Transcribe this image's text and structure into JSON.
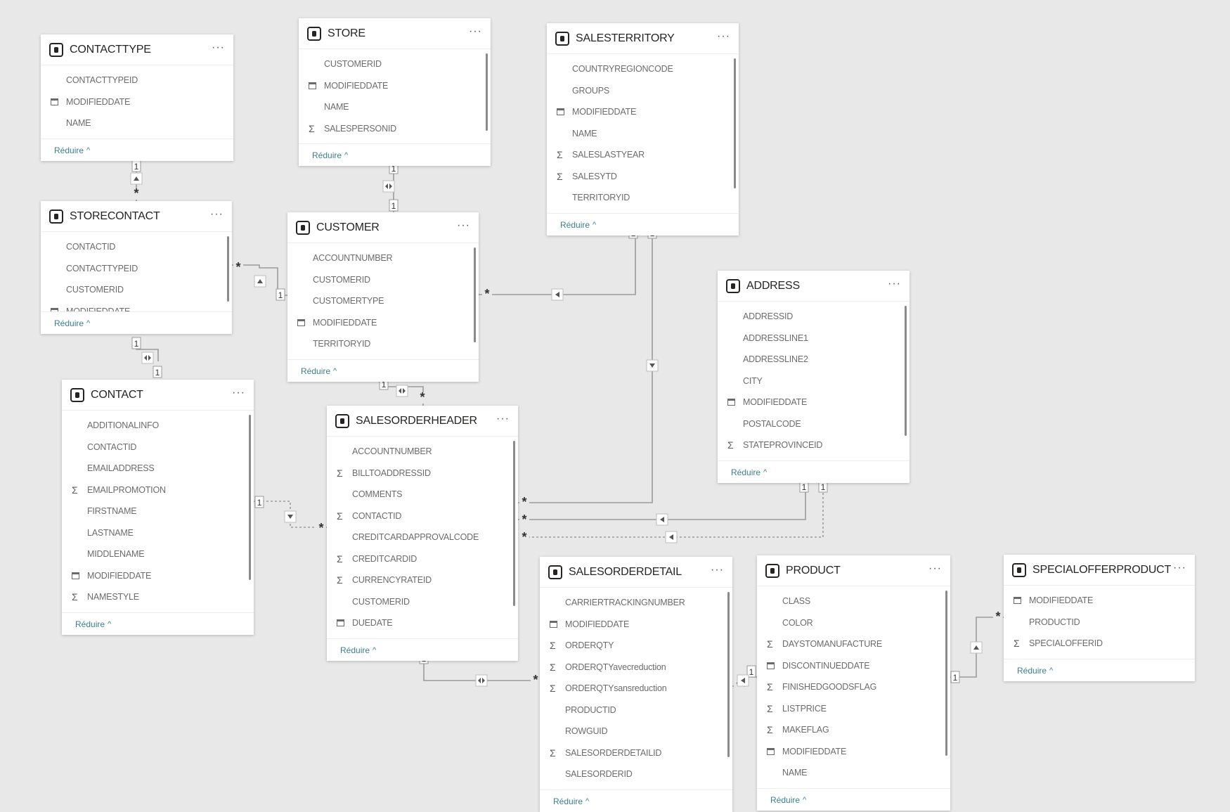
{
  "collapse_label": "Réduire",
  "collapse_chevron": "^",
  "more_label": "···",
  "tables": [
    {
      "id": "contacttype",
      "name": "CONTACTTYPE",
      "fields": [
        {
          "name": "CONTACTTYPEID",
          "icon": "none"
        },
        {
          "name": "MODIFIEDDATE",
          "icon": "calendar"
        },
        {
          "name": "NAME",
          "icon": "none"
        }
      ]
    },
    {
      "id": "store",
      "name": "STORE",
      "fields": [
        {
          "name": "CUSTOMERID",
          "icon": "none"
        },
        {
          "name": "MODIFIEDDATE",
          "icon": "calendar"
        },
        {
          "name": "NAME",
          "icon": "none"
        },
        {
          "name": "SALESPERSONID",
          "icon": "sigma"
        }
      ]
    },
    {
      "id": "salesterritory",
      "name": "SALESTERRITORY",
      "fields": [
        {
          "name": "COUNTRYREGIONCODE",
          "icon": "none"
        },
        {
          "name": "GROUPS",
          "icon": "none"
        },
        {
          "name": "MODIFIEDDATE",
          "icon": "calendar"
        },
        {
          "name": "NAME",
          "icon": "none"
        },
        {
          "name": "SALESLASTYEAR",
          "icon": "sigma"
        },
        {
          "name": "SALESYTD",
          "icon": "sigma"
        },
        {
          "name": "TERRITORYID",
          "icon": "none"
        }
      ]
    },
    {
      "id": "storecontact",
      "name": "STORECONTACT",
      "fields": [
        {
          "name": "CONTACTID",
          "icon": "none"
        },
        {
          "name": "CONTACTTYPEID",
          "icon": "none"
        },
        {
          "name": "CUSTOMERID",
          "icon": "none"
        },
        {
          "name": "MODIFIEDDATE",
          "icon": "calendar"
        }
      ]
    },
    {
      "id": "customer",
      "name": "CUSTOMER",
      "fields": [
        {
          "name": "ACCOUNTNUMBER",
          "icon": "none"
        },
        {
          "name": "CUSTOMERID",
          "icon": "none"
        },
        {
          "name": "CUSTOMERTYPE",
          "icon": "none"
        },
        {
          "name": "MODIFIEDDATE",
          "icon": "calendar"
        },
        {
          "name": "TERRITORYID",
          "icon": "none"
        }
      ]
    },
    {
      "id": "address",
      "name": "ADDRESS",
      "fields": [
        {
          "name": "ADDRESSID",
          "icon": "none"
        },
        {
          "name": "ADDRESSLINE1",
          "icon": "none"
        },
        {
          "name": "ADDRESSLINE2",
          "icon": "none"
        },
        {
          "name": "CITY",
          "icon": "none"
        },
        {
          "name": "MODIFIEDDATE",
          "icon": "calendar"
        },
        {
          "name": "POSTALCODE",
          "icon": "none"
        },
        {
          "name": "STATEPROVINCEID",
          "icon": "sigma"
        }
      ]
    },
    {
      "id": "contact",
      "name": "CONTACT",
      "fields": [
        {
          "name": "ADDITIONALINFO",
          "icon": "none"
        },
        {
          "name": "CONTACTID",
          "icon": "none"
        },
        {
          "name": "EMAILADDRESS",
          "icon": "none"
        },
        {
          "name": "EMAILPROMOTION",
          "icon": "sigma"
        },
        {
          "name": "FIRSTNAME",
          "icon": "none"
        },
        {
          "name": "LASTNAME",
          "icon": "none"
        },
        {
          "name": "MIDDLENAME",
          "icon": "none"
        },
        {
          "name": "MODIFIEDDATE",
          "icon": "calendar"
        },
        {
          "name": "NAMESTYLE",
          "icon": "sigma"
        }
      ]
    },
    {
      "id": "salesorderheader",
      "name": "SALESORDERHEADER",
      "fields": [
        {
          "name": "ACCOUNTNUMBER",
          "icon": "none"
        },
        {
          "name": "BILLTOADDRESSID",
          "icon": "sigma"
        },
        {
          "name": "COMMENTS",
          "icon": "none"
        },
        {
          "name": "CONTACTID",
          "icon": "sigma"
        },
        {
          "name": "CREDITCARDAPPROVALCODE",
          "icon": "none"
        },
        {
          "name": "CREDITCARDID",
          "icon": "sigma"
        },
        {
          "name": "CURRENCYRATEID",
          "icon": "sigma"
        },
        {
          "name": "CUSTOMERID",
          "icon": "none"
        },
        {
          "name": "DUEDATE",
          "icon": "calendar"
        }
      ]
    },
    {
      "id": "salesorderdetail",
      "name": "SALESORDERDETAIL",
      "fields": [
        {
          "name": "CARRIERTRACKINGNUMBER",
          "icon": "none"
        },
        {
          "name": "MODIFIEDDATE",
          "icon": "calendar"
        },
        {
          "name": "ORDERQTY",
          "icon": "sigma"
        },
        {
          "name": "ORDERQTYavecreduction",
          "icon": "sigma"
        },
        {
          "name": "ORDERQTYsansreduction",
          "icon": "sigma"
        },
        {
          "name": "PRODUCTID",
          "icon": "none"
        },
        {
          "name": "ROWGUID",
          "icon": "none"
        },
        {
          "name": "SALESORDERDETAILID",
          "icon": "sigma"
        },
        {
          "name": "SALESORDERID",
          "icon": "none"
        }
      ]
    },
    {
      "id": "product",
      "name": "PRODUCT",
      "fields": [
        {
          "name": "CLASS",
          "icon": "none"
        },
        {
          "name": "COLOR",
          "icon": "none"
        },
        {
          "name": "DAYSTOMANUFACTURE",
          "icon": "sigma"
        },
        {
          "name": "DISCONTINUEDDATE",
          "icon": "calendar"
        },
        {
          "name": "FINISHEDGOODSFLAG",
          "icon": "sigma"
        },
        {
          "name": "LISTPRICE",
          "icon": "sigma"
        },
        {
          "name": "MAKEFLAG",
          "icon": "sigma"
        },
        {
          "name": "MODIFIEDDATE",
          "icon": "calendar"
        },
        {
          "name": "NAME",
          "icon": "none"
        }
      ]
    },
    {
      "id": "specialofferproduct",
      "name": "SPECIALOFFERPRODUCT",
      "fields": [
        {
          "name": "MODIFIEDDATE",
          "icon": "calendar"
        },
        {
          "name": "PRODUCTID",
          "icon": "none"
        },
        {
          "name": "SPECIALOFFERID",
          "icon": "sigma"
        }
      ]
    }
  ],
  "relationships": [
    {
      "from": "contacttype",
      "to": "storecontact",
      "from_cardinality": "1",
      "to_cardinality": "*",
      "filter_direction": "single"
    },
    {
      "from": "store",
      "to": "customer",
      "from_cardinality": "1",
      "to_cardinality": "1",
      "filter_direction": "both"
    },
    {
      "from": "customer",
      "to": "storecontact",
      "from_cardinality": "1",
      "to_cardinality": "*",
      "filter_direction": "single"
    },
    {
      "from": "salesterritory",
      "to": "customer",
      "from_cardinality": "1",
      "to_cardinality": "*",
      "filter_direction": "single"
    },
    {
      "from": "salesterritory",
      "to": "salesorderheader",
      "from_cardinality": "1",
      "to_cardinality": "*",
      "filter_direction": "single"
    },
    {
      "from": "storecontact",
      "to": "contact",
      "from_cardinality": "1",
      "to_cardinality": "1",
      "filter_direction": "both"
    },
    {
      "from": "customer",
      "to": "salesorderheader",
      "from_cardinality": "1",
      "to_cardinality": "*",
      "filter_direction": "both"
    },
    {
      "from": "contact",
      "to": "salesorderheader",
      "from_cardinality": "1",
      "to_cardinality": "*",
      "filter_direction": "single",
      "inactive": true
    },
    {
      "from": "address",
      "to": "salesorderheader",
      "from_cardinality": "1",
      "to_cardinality": "*",
      "filter_direction": "single"
    },
    {
      "from": "address",
      "to": "salesorderheader",
      "from_cardinality": "1",
      "to_cardinality": "*",
      "filter_direction": "single",
      "inactive": true
    },
    {
      "from": "salesorderheader",
      "to": "salesorderdetail",
      "from_cardinality": "1",
      "to_cardinality": "*",
      "filter_direction": "both"
    },
    {
      "from": "product",
      "to": "salesorderdetail",
      "from_cardinality": "1",
      "to_cardinality": "*",
      "filter_direction": "single"
    },
    {
      "from": "product",
      "to": "specialofferproduct",
      "from_cardinality": "1",
      "to_cardinality": "*",
      "filter_direction": "single"
    }
  ]
}
